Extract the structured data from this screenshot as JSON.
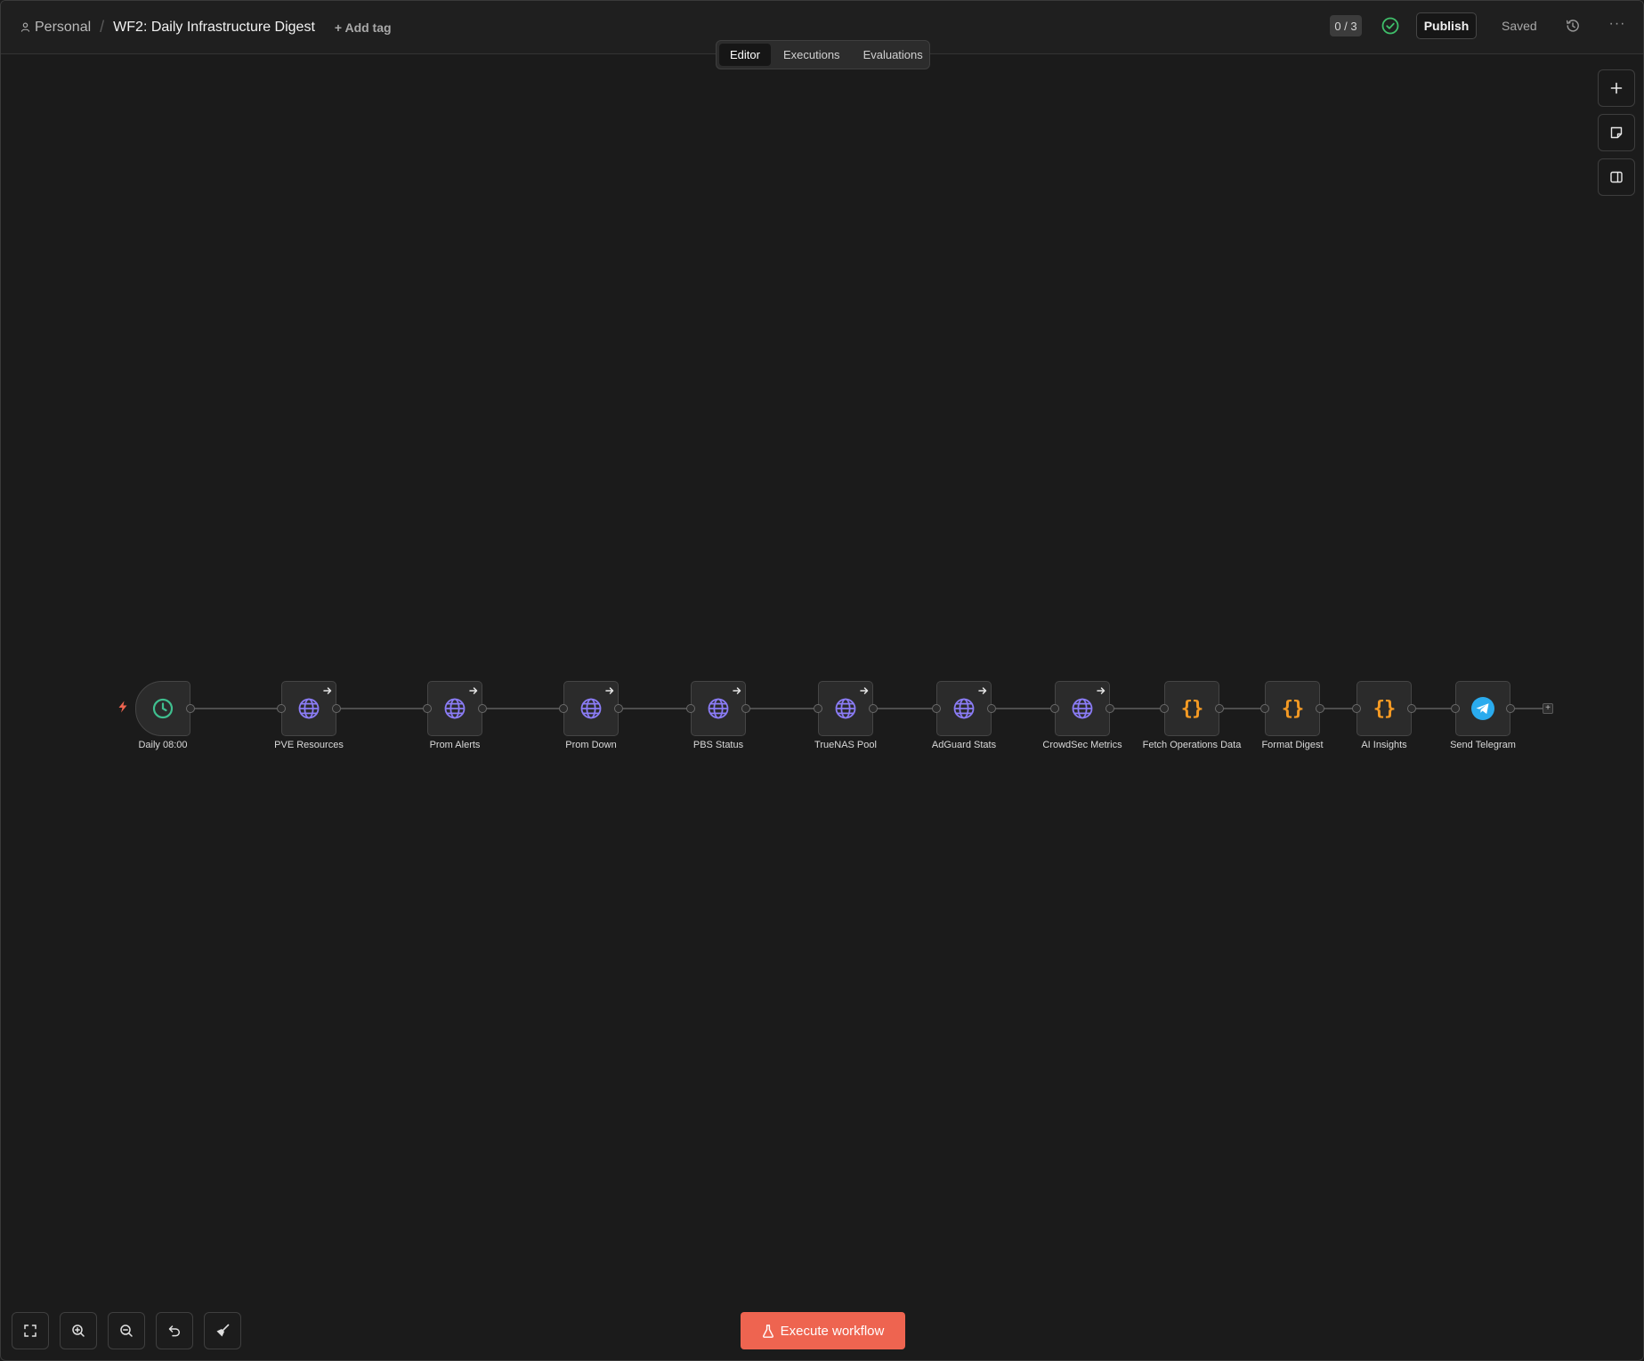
{
  "header": {
    "project": "Personal",
    "workflow_title": "WF2: Daily Infrastructure Digest",
    "add_tag": "+ Add tag",
    "counter": "0 / 3",
    "publish": "Publish",
    "saved": "Saved"
  },
  "tabs": [
    {
      "label": "Editor",
      "active": true
    },
    {
      "label": "Executions",
      "active": false
    },
    {
      "label": "Evaluations",
      "active": false
    }
  ],
  "nodes": [
    {
      "label": "Daily 08:00",
      "icon": "clock-icon"
    },
    {
      "label": "PVE Resources",
      "icon": "globe-icon"
    },
    {
      "label": "Prom Alerts",
      "icon": "globe-icon"
    },
    {
      "label": "Prom Down",
      "icon": "globe-icon"
    },
    {
      "label": "PBS Status",
      "icon": "globe-icon"
    },
    {
      "label": "TrueNAS Pool",
      "icon": "globe-icon"
    },
    {
      "label": "AdGuard Stats",
      "icon": "globe-icon"
    },
    {
      "label": "CrowdSec Metrics",
      "icon": "globe-icon"
    },
    {
      "label": "Fetch Operations Data",
      "icon": "code-braces-icon"
    },
    {
      "label": "Format Digest",
      "icon": "code-braces-icon"
    },
    {
      "label": "AI Insights",
      "icon": "code-braces-icon"
    },
    {
      "label": "Send Telegram",
      "icon": "telegram-icon"
    }
  ],
  "execute_label": "Execute workflow",
  "colors": {
    "accent": "#ee6450",
    "trigger_icon": "#3fbf8f",
    "http_icon": "#8b7cf6",
    "code_icon": "#f59a23",
    "telegram_icon": "#2aabee",
    "status_ok": "#3fbf6a"
  }
}
